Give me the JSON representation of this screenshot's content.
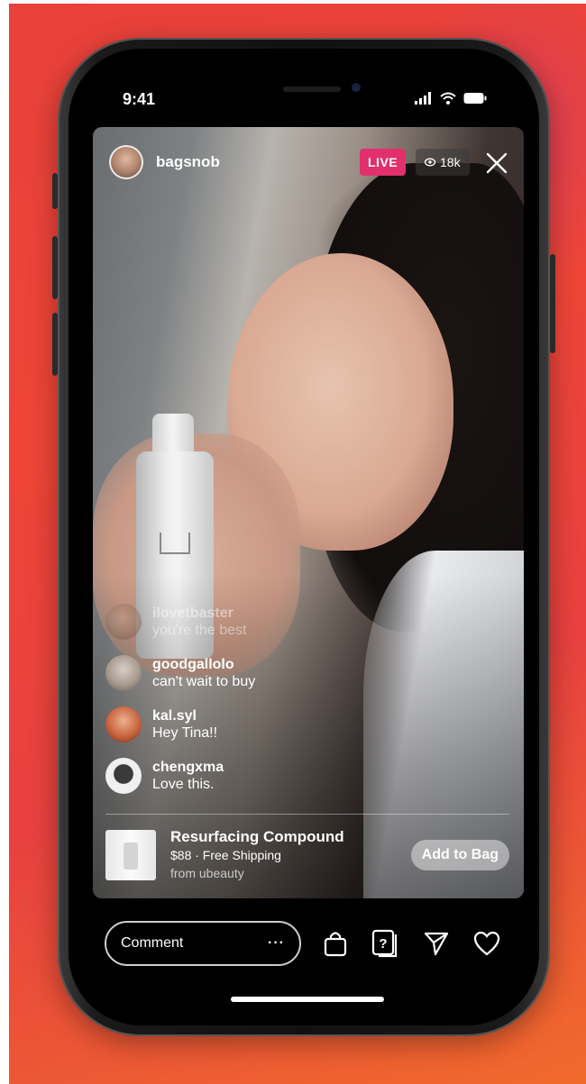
{
  "status_bar": {
    "time": "9:41"
  },
  "live": {
    "username": "bagsnob",
    "badge": "LIVE",
    "viewers": "18k"
  },
  "comments": [
    {
      "user": "ilovetbaster",
      "message": "you're the best",
      "faded": true,
      "avatar_color": "#8a6b5a"
    },
    {
      "user": "goodgallolo",
      "message": "can't wait to buy",
      "faded": false,
      "avatar_color": "#a79a8e"
    },
    {
      "user": "kal.syl",
      "message": "Hey Tina!!",
      "faded": false,
      "avatar_color": "#c9643f"
    },
    {
      "user": "chengxma",
      "message": "Love this.",
      "faded": false,
      "avatar_color": "#f0f0f0"
    }
  ],
  "product": {
    "name": "Resurfacing Compound",
    "price_line": "$88 · Free Shipping",
    "seller": "from ubeauty",
    "cta": "Add to Bag"
  },
  "composer": {
    "placeholder": "Comment",
    "more": "···"
  },
  "icons": [
    "shopping-bag-icon",
    "question-box-icon",
    "send-icon",
    "heart-icon"
  ],
  "colors": {
    "live_badge": "#e1306c",
    "background": "#e8413a"
  }
}
